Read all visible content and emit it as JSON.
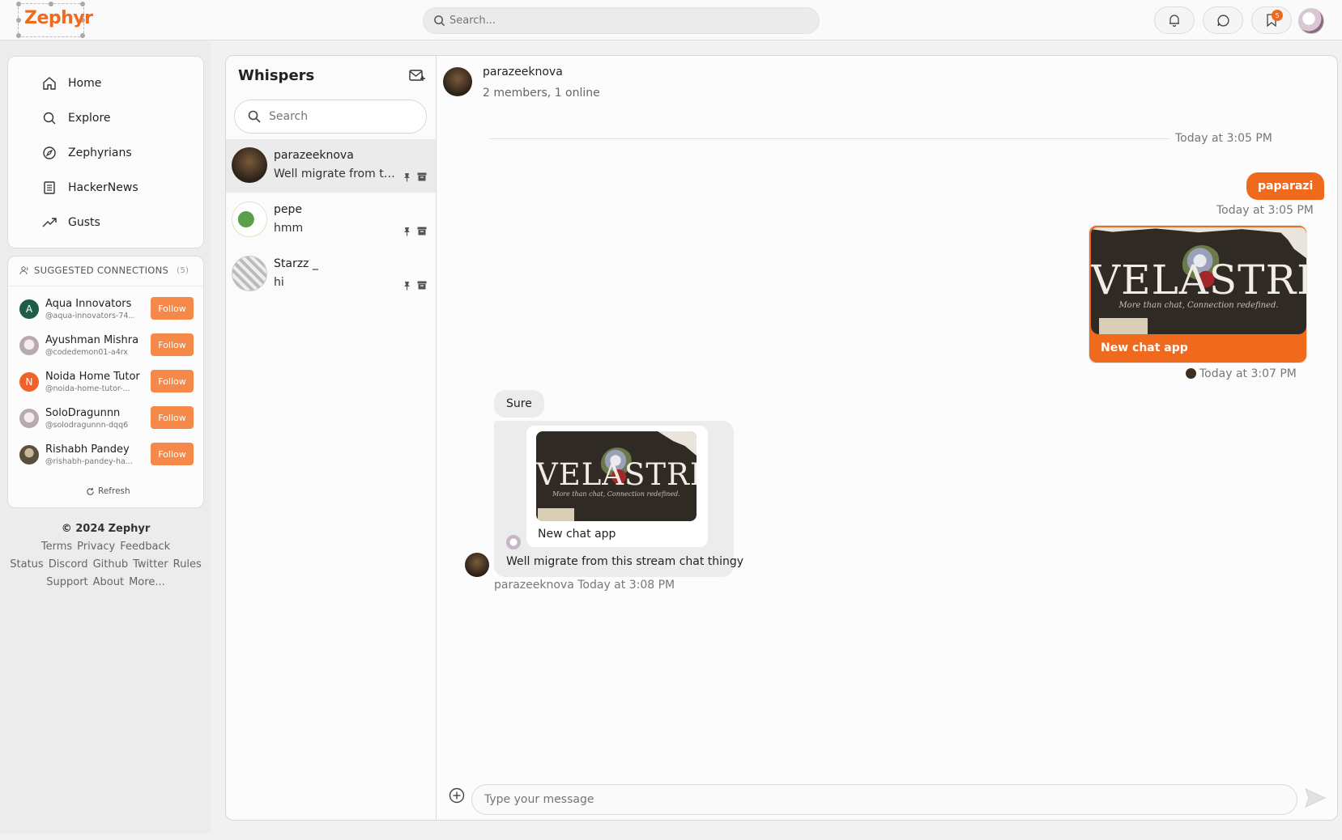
{
  "app": {
    "logo": "Zephyr"
  },
  "topbar": {
    "search_placeholder": "Search...",
    "icons": [
      "bell-icon",
      "chat-bubble-icon",
      "bookmark-icon"
    ],
    "bookmark_badge": "5"
  },
  "nav": {
    "items": [
      {
        "label": "Home",
        "icon": "home-icon"
      },
      {
        "label": "Explore",
        "icon": "search-icon"
      },
      {
        "label": "Zephyrians",
        "icon": "compass-icon"
      },
      {
        "label": "HackerNews",
        "icon": "newspaper-icon"
      },
      {
        "label": "Gusts",
        "icon": "trending-icon"
      }
    ]
  },
  "suggestions": {
    "title": "SUGGESTED CONNECTIONS",
    "count": "(5)",
    "follow_label": "Follow",
    "refresh_label": "Refresh",
    "items": [
      {
        "initial": "A",
        "name": "Aqua Innovators",
        "handle": "@aqua-innovators-74...",
        "color": "#1f5c4a"
      },
      {
        "initial": "",
        "name": "Ayushman Mishra",
        "handle": "@codedemon01-a4rx",
        "color": "#b9a9b0"
      },
      {
        "initial": "N",
        "name": "Noida Home Tutor",
        "handle": "@noida-home-tutor-...",
        "color": "#f0602a"
      },
      {
        "initial": "",
        "name": "SoloDragunnn",
        "handle": "@solodragunnn-dqq6",
        "color": "#b9a9b0"
      },
      {
        "initial": "",
        "name": "Rishabh Pandey",
        "handle": "@rishabh-pandey-ha...",
        "color": "#8a7f6a"
      }
    ]
  },
  "footer": {
    "copyright": "© 2024",
    "brand": "Zephyr",
    "links": [
      "Terms",
      "Privacy",
      "Feedback",
      "Status",
      "Discord",
      "Github",
      "Twitter",
      "Rules",
      "Support",
      "About",
      "More..."
    ]
  },
  "whispers": {
    "title": "Whispers",
    "search_placeholder": "Search",
    "threads": [
      {
        "name": "parazeeknova",
        "preview": "Well migrate from this stream chat thingy",
        "active": true
      },
      {
        "name": "pepe",
        "preview": "hmm",
        "active": false
      },
      {
        "name": "Starzz _",
        "preview": "hi",
        "active": false
      }
    ]
  },
  "chat": {
    "name": "parazeeknova",
    "status": "2 members, 1 online",
    "separator_time": "Today at 3:05 PM",
    "messages": {
      "me_text": "paparazi",
      "me_text_time": "Today at 3:05 PM",
      "me_card_caption": "New chat app",
      "me_card_time": "Today at 3:07 PM",
      "them_text": "Sure",
      "them_card_caption": "New chat app",
      "them_body": "Well migrate from this stream chat thingy",
      "them_meta": "parazeeknova Today at 3:08 PM"
    },
    "image_word": "VELASTRIA",
    "image_tagline": "More than chat, Connection redefined.",
    "composer_placeholder": "Type your message"
  },
  "colors": {
    "accent": "#f06a1e",
    "follow": "#f5894a"
  }
}
